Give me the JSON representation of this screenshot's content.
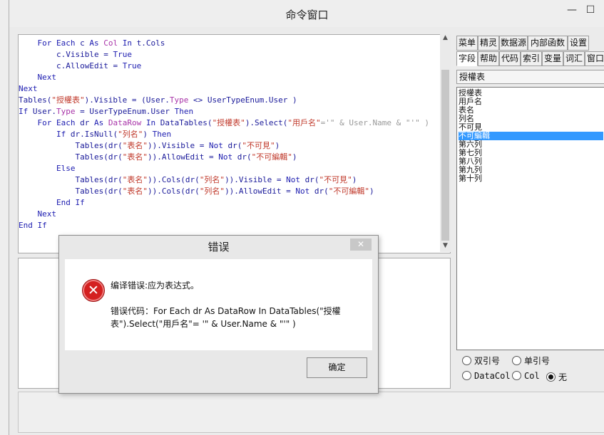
{
  "window": {
    "title": "命令窗口",
    "minimize": "—",
    "maximize": "☐"
  },
  "code_lines": [
    [
      {
        "t": "    For Each ",
        "c": "kw"
      },
      {
        "t": "c ",
        "c": ""
      },
      {
        "t": "As ",
        "c": "kw"
      },
      {
        "t": "Col ",
        "c": "tp"
      },
      {
        "t": "In ",
        "c": "kw"
      },
      {
        "t": "t.Cols",
        "c": ""
      }
    ],
    [
      {
        "t": "        c.Visible = ",
        "c": ""
      },
      {
        "t": "True",
        "c": "kw"
      }
    ],
    [
      {
        "t": "        c.AllowEdit = ",
        "c": ""
      },
      {
        "t": "True",
        "c": "kw"
      }
    ],
    [
      {
        "t": "    Next",
        "c": "kw"
      }
    ],
    [
      {
        "t": "Next",
        "c": "kw"
      }
    ],
    [
      {
        "t": "Tables(",
        "c": ""
      },
      {
        "t": "\"授權表\"",
        "c": "st"
      },
      {
        "t": ").Visible = (User.",
        "c": ""
      },
      {
        "t": "Type",
        "c": "tp"
      },
      {
        "t": " <> UserTypeEnum.User )",
        "c": ""
      }
    ],
    [
      {
        "t": "If ",
        "c": "kw"
      },
      {
        "t": "User.",
        "c": ""
      },
      {
        "t": "Type",
        "c": "tp"
      },
      {
        "t": " = UserTypeEnum.User ",
        "c": ""
      },
      {
        "t": "Then",
        "c": "kw"
      }
    ],
    [
      {
        "t": "    For Each ",
        "c": "kw"
      },
      {
        "t": "dr ",
        "c": ""
      },
      {
        "t": "As ",
        "c": "kw"
      },
      {
        "t": "DataRow ",
        "c": "tp"
      },
      {
        "t": "In ",
        "c": "kw"
      },
      {
        "t": "DataTables(",
        "c": ""
      },
      {
        "t": "\"授權表\"",
        "c": "st"
      },
      {
        "t": ").Select(",
        "c": ""
      },
      {
        "t": "\"用戶名\"",
        "c": "st"
      },
      {
        "t": "='\" & User.Name & \"'\" )",
        "c": "dm"
      }
    ],
    [
      {
        "t": "        If ",
        "c": "kw"
      },
      {
        "t": "dr.IsNull(",
        "c": ""
      },
      {
        "t": "\"列名\"",
        "c": "st"
      },
      {
        "t": ") ",
        "c": ""
      },
      {
        "t": "Then",
        "c": "kw"
      }
    ],
    [
      {
        "t": "            Tables(dr(",
        "c": ""
      },
      {
        "t": "\"表名\"",
        "c": "st"
      },
      {
        "t": ")).Visible = ",
        "c": ""
      },
      {
        "t": "Not ",
        "c": "kw"
      },
      {
        "t": "dr(",
        "c": ""
      },
      {
        "t": "\"不可見\"",
        "c": "st"
      },
      {
        "t": ")",
        "c": ""
      }
    ],
    [
      {
        "t": "            Tables(dr(",
        "c": ""
      },
      {
        "t": "\"表名\"",
        "c": "st"
      },
      {
        "t": ")).AllowEdit = ",
        "c": ""
      },
      {
        "t": "Not ",
        "c": "kw"
      },
      {
        "t": "dr(",
        "c": ""
      },
      {
        "t": "\"不可編輯\"",
        "c": "st"
      },
      {
        "t": ")",
        "c": ""
      }
    ],
    [
      {
        "t": "        Else",
        "c": "kw"
      }
    ],
    [
      {
        "t": "            Tables(dr(",
        "c": ""
      },
      {
        "t": "\"表名\"",
        "c": "st"
      },
      {
        "t": ")).Cols(dr(",
        "c": ""
      },
      {
        "t": "\"列名\"",
        "c": "st"
      },
      {
        "t": ")).Visible = ",
        "c": ""
      },
      {
        "t": "Not ",
        "c": "kw"
      },
      {
        "t": "dr(",
        "c": ""
      },
      {
        "t": "\"不可見\"",
        "c": "st"
      },
      {
        "t": ")",
        "c": ""
      }
    ],
    [
      {
        "t": "            Tables(dr(",
        "c": ""
      },
      {
        "t": "\"表名\"",
        "c": "st"
      },
      {
        "t": ")).Cols(dr(",
        "c": ""
      },
      {
        "t": "\"列名\"",
        "c": "st"
      },
      {
        "t": ")).AllowEdit = ",
        "c": ""
      },
      {
        "t": "Not ",
        "c": "kw"
      },
      {
        "t": "dr(",
        "c": ""
      },
      {
        "t": "\"不可編輯\"",
        "c": "st"
      },
      {
        "t": ")",
        "c": ""
      }
    ],
    [
      {
        "t": "        End If",
        "c": "kw"
      }
    ],
    [
      {
        "t": "    Next",
        "c": "kw"
      }
    ],
    [
      {
        "t": "End If",
        "c": "kw"
      }
    ]
  ],
  "side_panel": {
    "tabs_row1": [
      "菜单",
      "精灵",
      "数据源",
      "内部函数",
      "设置"
    ],
    "tabs_row2": [
      "字段",
      "帮助",
      "代码",
      "索引",
      "变量",
      "词汇",
      "窗口"
    ],
    "active_tab": "字段",
    "table_select": "授權表",
    "fields": [
      "授權表",
      "用戶名",
      "表名",
      "列名",
      "不可見",
      "不可編輯",
      "第六列",
      "第七列",
      "第八列",
      "第九列",
      "第十列"
    ],
    "selected_field": "不可編輯",
    "options": {
      "double_quote": "双引号",
      "single_quote": "单引号",
      "datacol": "DataCol",
      "col": "Col",
      "none": "无"
    }
  },
  "dialog": {
    "title": "错误",
    "close": "✕",
    "icon": "error-icon",
    "message": "编译错误:应为表达式。",
    "detail": "错误代码：For Each dr As DataRow In DataTables(\"授權表\").Select(\"用戶名\"= '\" & User.Name & \"'\" )",
    "ok_label": "确定"
  },
  "colors": {
    "keyword": "#1c1cb0",
    "type": "#a833a8",
    "string": "#c0392b",
    "selection": "#3399ff",
    "error": "#d42020"
  }
}
